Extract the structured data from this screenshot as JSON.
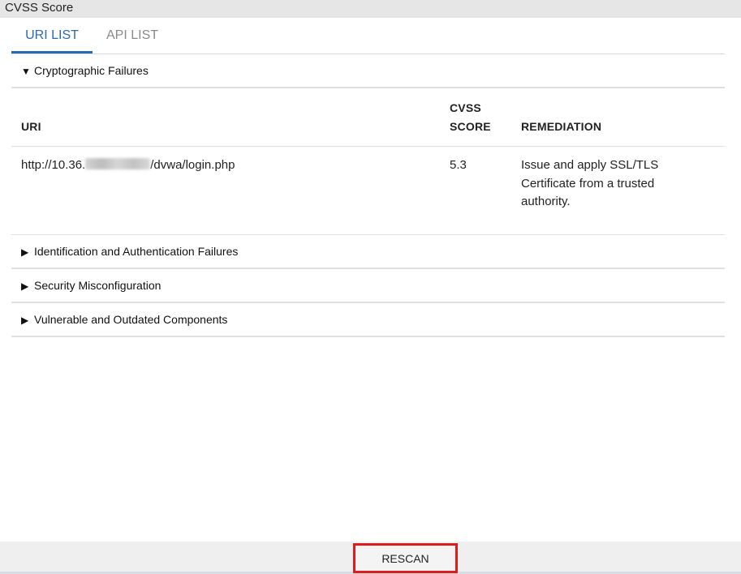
{
  "window": {
    "title": "CVSS Score"
  },
  "tabs": [
    {
      "label": "URI LIST"
    },
    {
      "label": "API LIST"
    }
  ],
  "sections": [
    {
      "label": "Cryptographic Failures",
      "expanded": true
    },
    {
      "label": "Identification and Authentication Failures",
      "expanded": false
    },
    {
      "label": "Security Misconfiguration",
      "expanded": false
    },
    {
      "label": "Vulnerable and Outdated Components",
      "expanded": false
    }
  ],
  "table": {
    "headers": {
      "uri": "URI",
      "cvss_line1": "CVSS",
      "cvss_line2": "SCORE",
      "remediation": "REMEDIATION"
    },
    "rows": [
      {
        "uri_prefix": "http://10.36.",
        "uri_suffix": "/dvwa/login.php",
        "score": "5.3",
        "remediation_lines": [
          "Issue and apply SSL/TLS",
          "Certificate from a trusted",
          "authority."
        ]
      }
    ]
  },
  "footer": {
    "rescan_label": "RESCAN"
  },
  "icons": {
    "expanded": "triangle-down-icon",
    "collapsed": "triangle-right-icon"
  },
  "colors": {
    "accent": "#2b69b2",
    "highlight": "#e01b1b"
  }
}
